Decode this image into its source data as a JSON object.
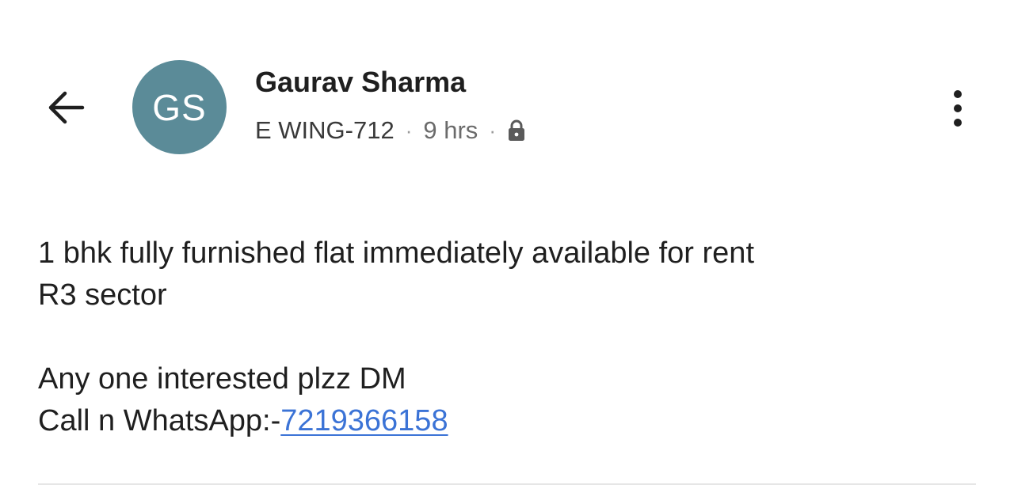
{
  "header": {
    "back_icon": "arrow-left-icon",
    "avatar": {
      "initials": "GS",
      "color": "#5b8b98"
    },
    "author_name": "Gaurav Sharma",
    "meta": {
      "location": "E WING-712",
      "separator": "·",
      "time": "9 hrs",
      "visibility_icon": "lock-icon"
    },
    "menu_icon": "more-vertical-icon"
  },
  "post": {
    "line1": "1 bhk fully furnished flat immediately available for rent",
    "line2": "R3 sector",
    "line3": "Any one interested plzz DM",
    "contact_prefix": "Call n WhatsApp:-",
    "phone": "7219366158"
  },
  "colors": {
    "link": "#3b73d6",
    "text": "#1f1f1f",
    "muted": "#6b6b6b",
    "divider": "#e6e6e6"
  }
}
